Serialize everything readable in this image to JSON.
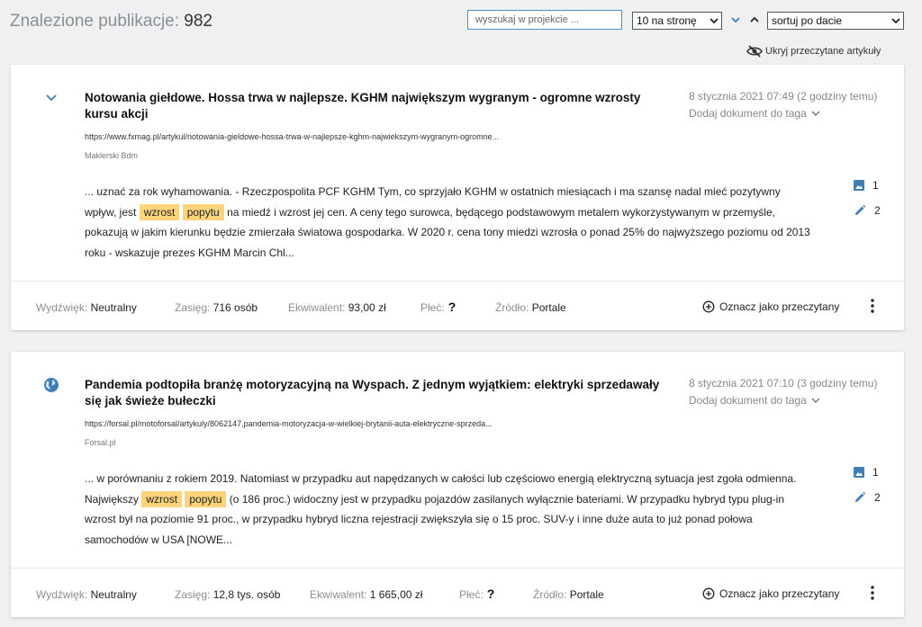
{
  "header": {
    "found_label": "Znalezione publikacje:",
    "found_count": "982",
    "search_placeholder": "wyszukaj w projekcie ...",
    "per_page": "10 na stronę",
    "sort": "sortuj po dacie",
    "hide_read": "Ukryj przeczytane artykuły"
  },
  "icons": {
    "sort_down": "chevron-down-icon",
    "sort_up": "chevron-up-icon",
    "hide": "eye-off-icon",
    "image": "image-icon",
    "pen": "pen-icon",
    "mark_read": "plus-circle-icon",
    "menu": "more-vertical-icon",
    "card1_lead": "chevron-down-icon",
    "card2_lead": "globe-icon"
  },
  "colors": {
    "accent": "#4a8fd0",
    "highlight": "#fdd47a",
    "icon_blue": "#3f7fb8"
  },
  "articles": [
    {
      "title": "Notowania giełdowe. Hossa trwa w najlepsze. KGHM największym wygranym - ogromne wzrosty kursu akcji",
      "url": "https://www.fxmag.pl/artykul/notowania-gieldowe-hossa-trwa-w-najlepsze-kghm-najwiekszym-wygranym-ogromne...",
      "source": "Maklerski Bdm",
      "date": "8 stycznia 2021 07:49 (2 godziny temu)",
      "tag_action": "Dodaj dokument do taga",
      "snippet": {
        "before": "... uznać za rok wyhamowania. - Rzeczpospolita PCF KGHM Tym, co sprzyjało KGHM w ostatnich miesiącach i ma szansę nadal mieć pozytywny wpływ, jest ",
        "hl1": "wzrost",
        "hl2": "popytu",
        "after": " na miedź i wzrost jej cen. A ceny tego surowca, będącego podstawowym metalem wykorzystywanym w przemyśle, pokazują w jakim kierunku będzie zmierzała światowa gospodarka. W 2020 r. cena tony miedzi wzrosła o ponad 25% do najwyższego poziomu od 2013 roku - wskazuje prezes KGHM Marcin Chl..."
      },
      "images_count": "1",
      "notes_count": "2",
      "footer": {
        "sentiment_label": "Wydźwięk:",
        "sentiment": "Neutralny",
        "reach_label": "Zasięg:",
        "reach": "716 osób",
        "equiv_label": "Ekwiwalent:",
        "equiv": "93,00 zł",
        "gender_label": "Płeć:",
        "gender": "?",
        "source_label": "Źródło:",
        "source_type": "Portale",
        "mark_read": "Oznacz jako przeczytany"
      }
    },
    {
      "title": "Pandemia podtopiła branżę motoryzacyjną na Wyspach. Z jednym wyjątkiem: elektryki sprzedawały się jak świeże bułeczki",
      "url": "https://forsal.pl/motoforsal/artykuly/8062147,pandemia-motoryzacja-w-wielkiej-brytanii-auta-elektryczne-sprzeda...",
      "source": "Forsal.pl",
      "date": "8 stycznia 2021 07:10 (3 godziny temu)",
      "tag_action": "Dodaj dokument do taga",
      "snippet": {
        "before": "... w porównaniu z rokiem 2019. Natomiast w przypadku aut napędzanych w całości lub częściowo energią elektryczną sytuacja jest zgoła odmienna. Największy ",
        "hl1": "wzrost",
        "hl2": "popytu",
        "after": " (o 186 proc.) widoczny jest w przypadku pojazdów zasilanych wyłącznie bateriami. W przypadku hybryd typu plug-in wzrost był na poziomie 91 proc., w przypadku hybryd liczna rejestracji zwiększyła się o 15 proc. SUV-y i inne duże auta to już ponad połowa samochodów w USA [NOWE..."
      },
      "images_count": "1",
      "notes_count": "2",
      "footer": {
        "sentiment_label": "Wydźwięk:",
        "sentiment": "Neutralny",
        "reach_label": "Zasięg:",
        "reach": "12,8 tys. osób",
        "equiv_label": "Ekwiwalent:",
        "equiv": "1 665,00 zł",
        "gender_label": "Płeć:",
        "gender": "?",
        "source_label": "Źródło:",
        "source_type": "Portale",
        "mark_read": "Oznacz jako przeczytany"
      }
    }
  ]
}
